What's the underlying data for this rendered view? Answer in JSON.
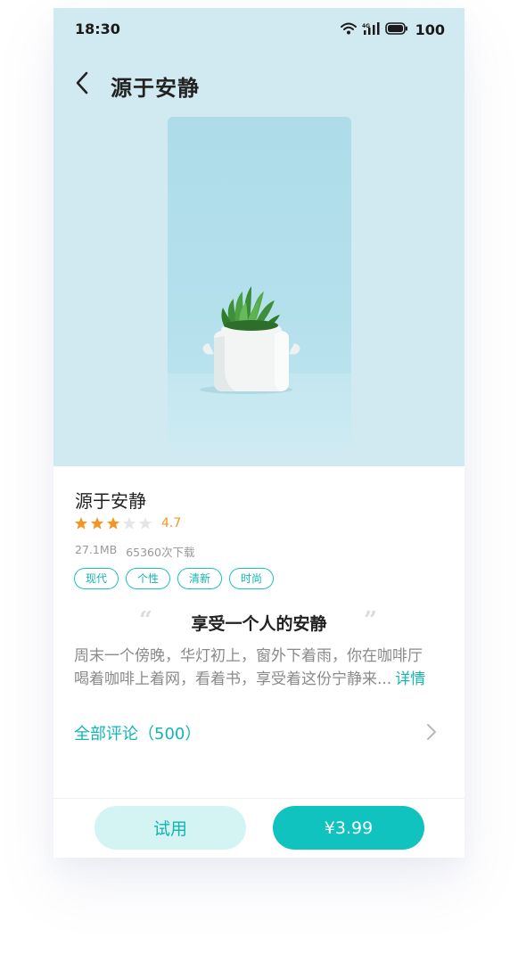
{
  "status_bar": {
    "time": "18:30",
    "battery": "100",
    "icons": [
      "wifi-icon",
      "cellular-signal-icon",
      "battery-icon"
    ]
  },
  "nav": {
    "back_icon": "chevron-left-icon",
    "title": "源于安静"
  },
  "theme": {
    "name": "源于安静",
    "rating_value": "4.7",
    "stars_filled": 3,
    "stars_total": 5,
    "size": "27.1MB",
    "downloads": "65360次下载",
    "tags": [
      "现代",
      "个性",
      "清新",
      "时尚"
    ],
    "slogan": "享受一个人的安静",
    "description_line1": "周末一个傍晚，华灯初上，窗外下着雨，你在咖啡厅",
    "description_line2": "喝着咖啡上着网，看着书，享受着这份宁静来...",
    "detail_link": "详情"
  },
  "reviews": {
    "label": "全部评论（500）",
    "chevron_icon": "chevron-right-icon"
  },
  "actions": {
    "trial_label": "试用",
    "buy_label": "¥3.99"
  },
  "colors": {
    "accent": "#12b6b4",
    "star": "#f5951f",
    "hero_bg": "#d1e9f1"
  }
}
